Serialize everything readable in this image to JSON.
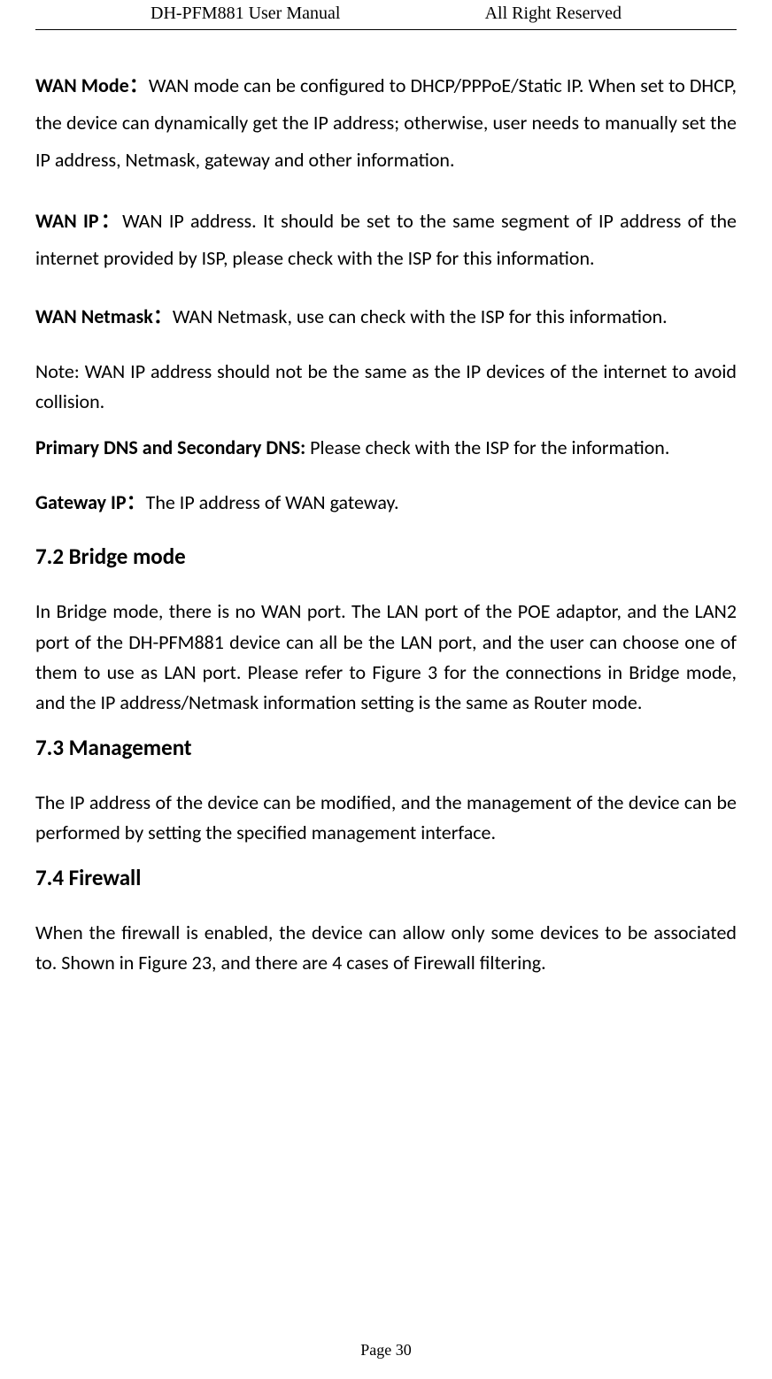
{
  "header": {
    "left": "DH-PFM881 User Manual",
    "right": "All Right Reserved"
  },
  "sections": {
    "wan_mode": {
      "label": "WAN Mode：",
      "text": "WAN mode can be configured to DHCP/PPPoE/Static IP. When set to DHCP, the device can dynamically get the IP address; otherwise, user needs to manually set the IP address, Netmask, gateway and other information."
    },
    "wan_ip": {
      "label": "WAN IP：",
      "text": "WAN IP address. It should be set to the same segment of IP address of the internet provided by ISP, please check with the ISP for this information."
    },
    "wan_netmask": {
      "label": "WAN Netmask：",
      "text": "WAN Netmask, use can check with the ISP for this information."
    },
    "note": {
      "text": "Note: WAN IP address should not be the same as the IP devices of the internet to avoid collision."
    },
    "dns": {
      "label": "Primary DNS and Secondary DNS: ",
      "text": "Please check with the ISP for the information."
    },
    "gateway": {
      "label": "Gateway IP：",
      "text": "The IP address of WAN gateway."
    },
    "h_bridge": "7.2  Bridge mode",
    "bridge_body": "In Bridge mode, there is no WAN port. The LAN port of the POE adaptor, and the LAN2 port of the DH-PFM881 device can all be the LAN port, and the user can choose one of them to use as LAN port. Please refer to Figure 3 for the connections in Bridge mode, and the IP address/Netmask information setting is the same as Router mode.",
    "h_mgmt": "7.3  Management",
    "mgmt_body": "The IP address of the device can be modified, and the management of the device can be performed by setting the specified management interface.",
    "h_firewall": "7.4  Firewall",
    "firewall_body": "When the firewall is enabled, the device can allow only some devices to be associated to. Shown in Figure 23, and there are 4 cases of Firewall filtering."
  },
  "footer": "Page 30"
}
